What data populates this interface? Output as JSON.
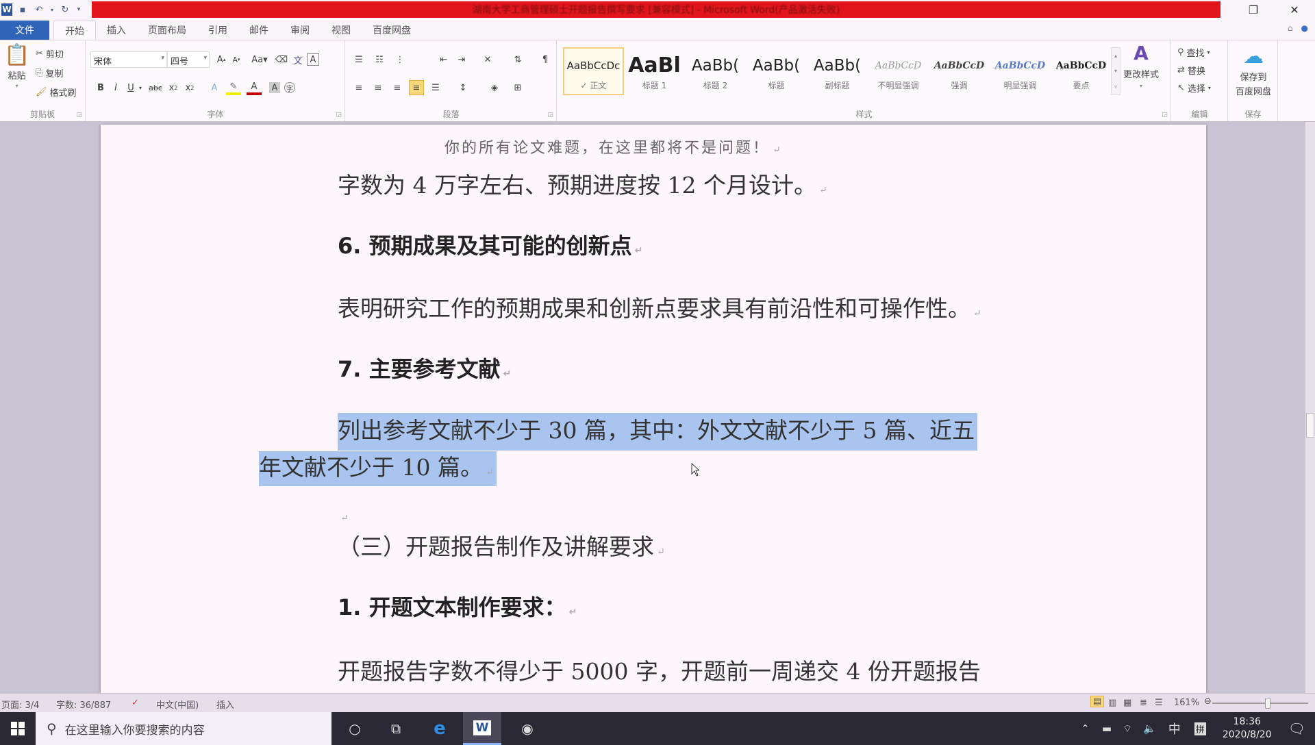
{
  "titlebar": {
    "title": "湖南大学工商管理硕士开题报告撰写要求 [兼容模式] - Microsoft Word(产品激活失败)",
    "qat": {
      "app_icon": "W",
      "save_icon": "save-icon",
      "undo_icon": "undo-icon",
      "redo_icon": "redo-icon",
      "customize_icon": "dropdown-icon"
    },
    "window_buttons": {
      "restore": "❐",
      "close": "✕"
    }
  },
  "tabs": [
    {
      "label": "文件",
      "type": "file"
    },
    {
      "label": "开始",
      "active": true
    },
    {
      "label": "插入"
    },
    {
      "label": "页面布局"
    },
    {
      "label": "引用"
    },
    {
      "label": "邮件"
    },
    {
      "label": "审阅"
    },
    {
      "label": "视图"
    },
    {
      "label": "百度网盘"
    }
  ],
  "ribbon": {
    "clipboard": {
      "label": "剪贴板",
      "paste": "粘贴",
      "cut": "剪切",
      "copy": "复制",
      "format_painter": "格式刷"
    },
    "font": {
      "label": "字体",
      "font_name": "宋体",
      "font_size": "四号",
      "buttons": [
        "A↑",
        "A↓",
        "Aa",
        "清除格式",
        "拼音",
        "字符边框"
      ],
      "format_buttons": [
        "B",
        "I",
        "U",
        "abc",
        "x₂",
        "x²"
      ]
    },
    "paragraph": {
      "label": "段落",
      "justify_active": true
    },
    "styles": {
      "label": "样式",
      "items": [
        {
          "sample": "AaBbCcDc",
          "name": "正文",
          "selected": true,
          "check": "✓"
        },
        {
          "sample": "AaBl",
          "name": "标题 1"
        },
        {
          "sample": "AaBb(",
          "name": "标题 2"
        },
        {
          "sample": "AaBb(",
          "name": "标题"
        },
        {
          "sample": "AaBb(",
          "name": "副标题"
        },
        {
          "sample": "AaBbCcD",
          "name": "不明显强调"
        },
        {
          "sample": "AaBbCcD",
          "name": "强调"
        },
        {
          "sample": "AaBbCcD",
          "name": "明显强调"
        },
        {
          "sample": "AaBbCcD",
          "name": "要点"
        }
      ],
      "change_styles": "更改样式"
    },
    "editing": {
      "label": "编辑",
      "find": "查找",
      "replace": "替换",
      "select": "选择"
    },
    "save": {
      "label": "保存",
      "save_to_baidu_line1": "保存到",
      "save_to_baidu_line2": "百度网盘"
    }
  },
  "document": {
    "header_note": "你的所有论文难题，在这里都将不是问题！",
    "paragraphs": [
      {
        "text": "字数为 4 万字左右、预期进度按 12 个月设计。",
        "style": "body"
      },
      {
        "text": "6. 预期成果及其可能的创新点",
        "style": "heading"
      },
      {
        "text": "表明研究工作的预期成果和创新点要求具有前沿性和可操作性。",
        "style": "body"
      },
      {
        "text": "7. 主要参考文献",
        "style": "heading"
      },
      {
        "text_line1": "列出参考文献不少于 30 篇，其中：外文文献不少于 5 篇、近五",
        "text_line2": "年文献不少于 10 篇。",
        "style": "body",
        "selected": true
      },
      {
        "text": "（三）开题报告制作及讲解要求",
        "style": "body"
      },
      {
        "text": "1. 开题文本制作要求：",
        "style": "heading"
      },
      {
        "text": "开题报告字数不得少于 5000 字，开题前一周递交 4 份开题报告",
        "style": "body"
      }
    ],
    "paragraph_mark": "↵"
  },
  "statusbar": {
    "page": "页面: 3/4",
    "words": "字数: 36/887",
    "language": "中文(中国)",
    "mode": "插入",
    "zoom": "161%",
    "zoom_percent": 161
  },
  "taskbar": {
    "search_placeholder": "在这里输入你要搜索的内容",
    "apps": [
      "cortana",
      "task-view",
      "edge",
      "word",
      "other-app"
    ],
    "ime_lang": "中",
    "ime_mode": "拼",
    "time": "18:36",
    "date": "2020/8/20"
  }
}
